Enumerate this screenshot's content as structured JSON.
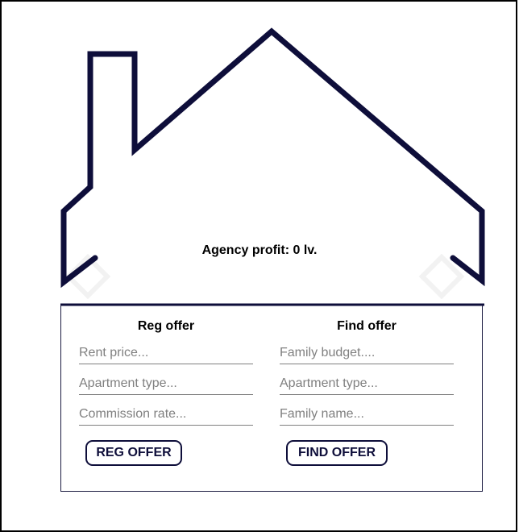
{
  "profit": {
    "text": "Agency profit: 0 lv."
  },
  "reg_offer": {
    "title": "Reg offer",
    "rent_price_placeholder": "Rent price...",
    "apartment_type_placeholder": "Apartment type...",
    "commission_rate_placeholder": "Commission rate...",
    "button_label": "REG OFFER"
  },
  "find_offer": {
    "title": "Find offer",
    "family_budget_placeholder": "Family budget....",
    "apartment_type_placeholder": "Apartment type...",
    "family_name_placeholder": "Family name...",
    "button_label": "FIND OFFER"
  },
  "colors": {
    "house_stroke": "#0e0e3a"
  }
}
